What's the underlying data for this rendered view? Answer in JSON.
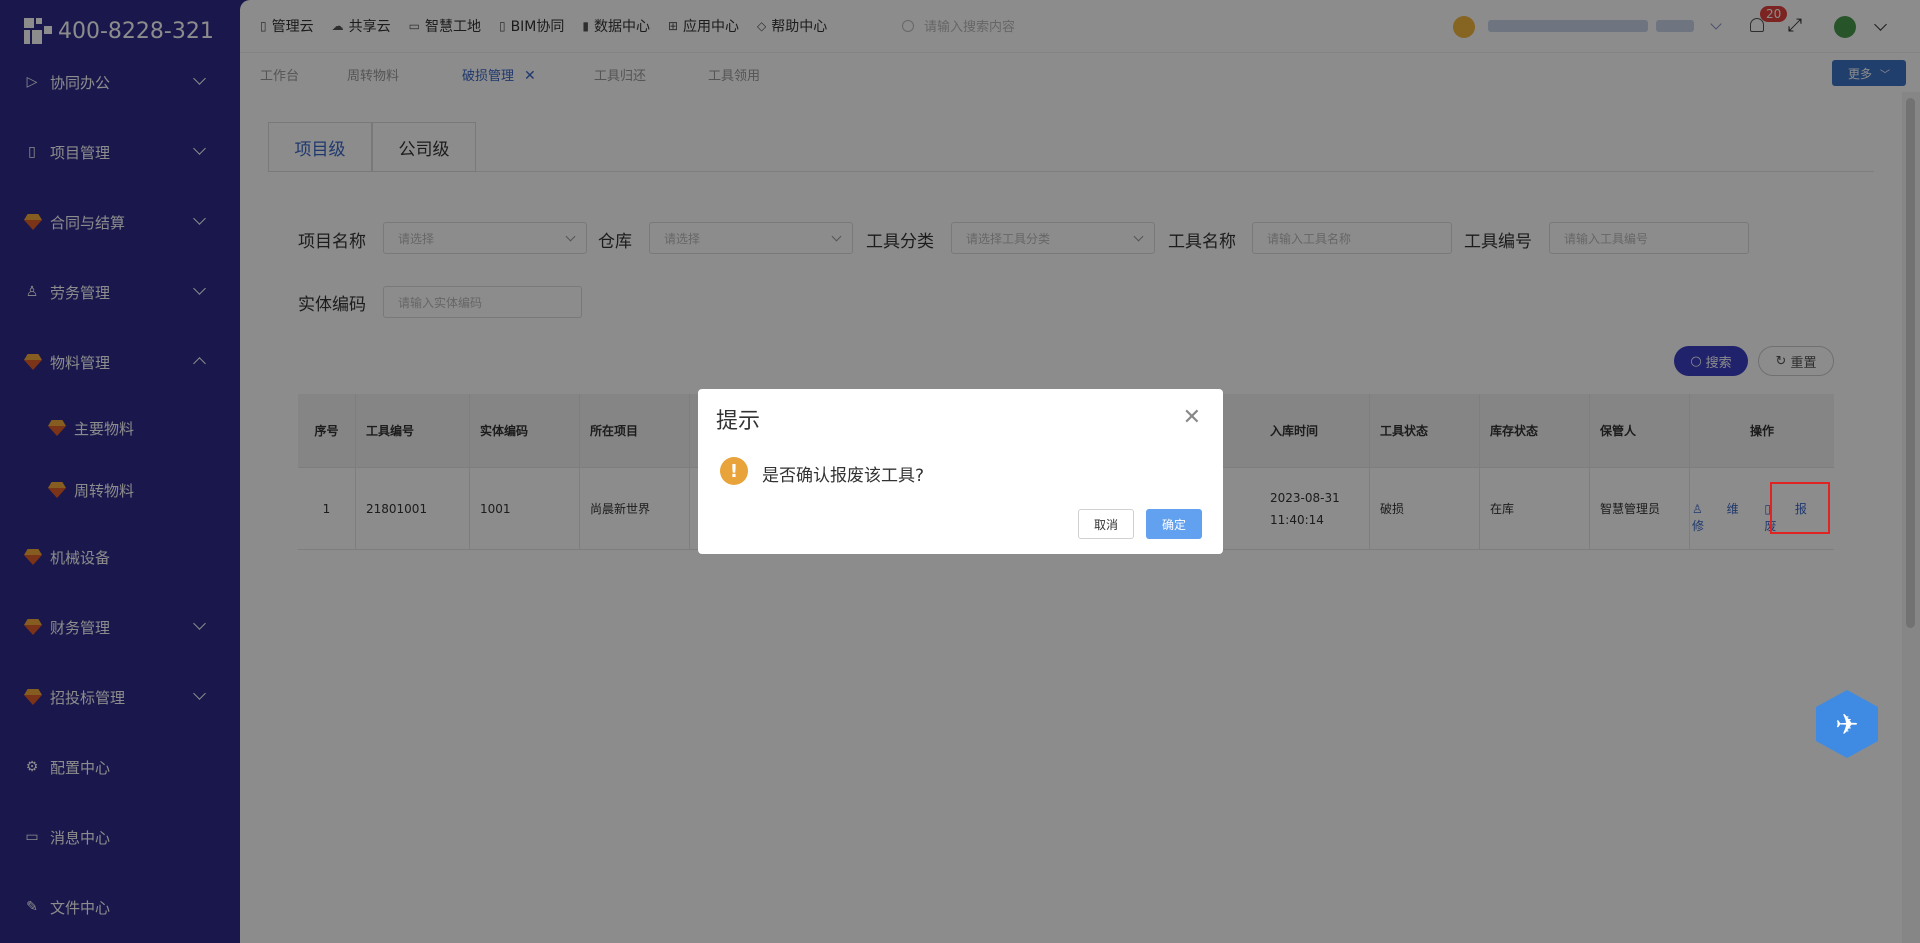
{
  "brand": {
    "phone": "400-8228-321"
  },
  "sidebar": {
    "items": [
      {
        "label": "协同办公",
        "icon": "send-icon",
        "chevron": "down"
      },
      {
        "label": "项目管理",
        "icon": "book-icon",
        "chevron": "down"
      },
      {
        "label": "合同与结算",
        "icon": "gem-icon",
        "chevron": "down"
      },
      {
        "label": "劳务管理",
        "icon": "user-icon",
        "chevron": "down"
      },
      {
        "label": "物料管理",
        "icon": "gem-icon",
        "chevron": "up"
      },
      {
        "label": "主要物料",
        "icon": "gem-icon",
        "sub": true
      },
      {
        "label": "周转物料",
        "icon": "gem-icon",
        "sub": true
      },
      {
        "label": "机械设备",
        "icon": "gem-icon"
      },
      {
        "label": "财务管理",
        "icon": "gem-icon",
        "chevron": "down"
      },
      {
        "label": "招投标管理",
        "icon": "gem-icon",
        "chevron": "down"
      },
      {
        "label": "配置中心",
        "icon": "gear-icon"
      },
      {
        "label": "消息中心",
        "icon": "message-icon"
      },
      {
        "label": "文件中心",
        "icon": "file-icon"
      }
    ]
  },
  "topnav": {
    "items": [
      "管理云",
      "共享云",
      "智慧工地",
      "BIM协同",
      "数据中心",
      "应用中心",
      "帮助中心"
    ],
    "search_placeholder": "请输入搜索内容",
    "badge_count": "20"
  },
  "tabs": {
    "items": [
      {
        "label": "工作台"
      },
      {
        "label": "周转物料"
      },
      {
        "label": "破损管理",
        "active": true
      },
      {
        "label": "工具归还"
      },
      {
        "label": "工具领用"
      }
    ],
    "more_label": "更多"
  },
  "level_tabs": [
    "项目级",
    "公司级"
  ],
  "filters": {
    "project_label": "项目名称",
    "project_placeholder": "请选择",
    "warehouse_label": "仓库",
    "warehouse_placeholder": "请选择",
    "category_label": "工具分类",
    "category_placeholder": "请选择工具分类",
    "toolname_label": "工具名称",
    "toolname_placeholder": "请输入工具名称",
    "toolno_label": "工具编号",
    "toolno_placeholder": "请输入工具编号",
    "entity_label": "实体编码",
    "entity_placeholder": "请输入实体编码",
    "search_label": "搜索",
    "reset_label": "重置"
  },
  "table": {
    "headers": [
      "序号",
      "工具编号",
      "实体编码",
      "所在项目",
      "入库时间",
      "工具状态",
      "库存状态",
      "保管人",
      "操作"
    ],
    "rows": [
      {
        "index": "1",
        "tool_no": "21801001",
        "entity_code": "1001",
        "project": "尚晨新世界",
        "in_time": "2023-08-31 11:40:14",
        "tool_status": "破损",
        "stock_status": "在库",
        "keeper": "智慧管理员",
        "op_repair": "维修",
        "op_scrap": "报废"
      }
    ]
  },
  "dialog": {
    "title": "提示",
    "message": "是否确认报废该工具?",
    "cancel_label": "取消",
    "ok_label": "确定"
  }
}
